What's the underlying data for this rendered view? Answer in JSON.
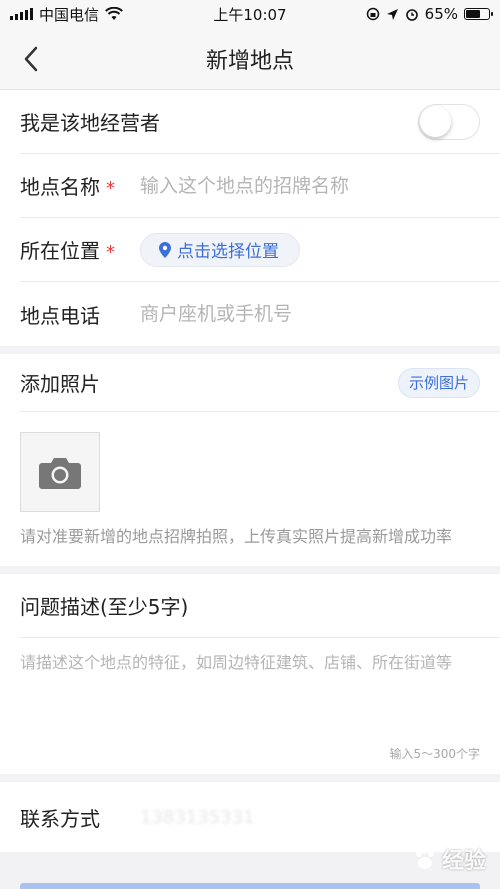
{
  "status_bar": {
    "carrier": "中国电信",
    "time": "上午10:07",
    "battery": "65%",
    "battery_level": 0.65
  },
  "navbar": {
    "title": "新增地点"
  },
  "form": {
    "operator_label": "我是该地经营者",
    "operator_on": false,
    "name_label": "地点名称",
    "name_placeholder": "输入这个地点的招牌名称",
    "required_mark": "*",
    "location_label": "所在位置",
    "location_button": "点击选择位置",
    "phone_label": "地点电话",
    "phone_placeholder": "商户座机或手机号"
  },
  "photo": {
    "title": "添加照片",
    "example_button": "示例图片",
    "hint": "请对准要新增的地点招牌拍照，上传真实照片提高新增成功率"
  },
  "description": {
    "title": "问题描述(至少5字)",
    "placeholder": "请描述这个地点的特征，如周边特征建筑、店铺、所在街道等",
    "counter": "输入5～300个字"
  },
  "contact": {
    "label": "联系方式",
    "value": "1383135331"
  },
  "watermark": {
    "text": "经验"
  },
  "colors": {
    "accent": "#3d6fd8",
    "required": "#e4393c",
    "placeholder": "#b5b5b5"
  }
}
